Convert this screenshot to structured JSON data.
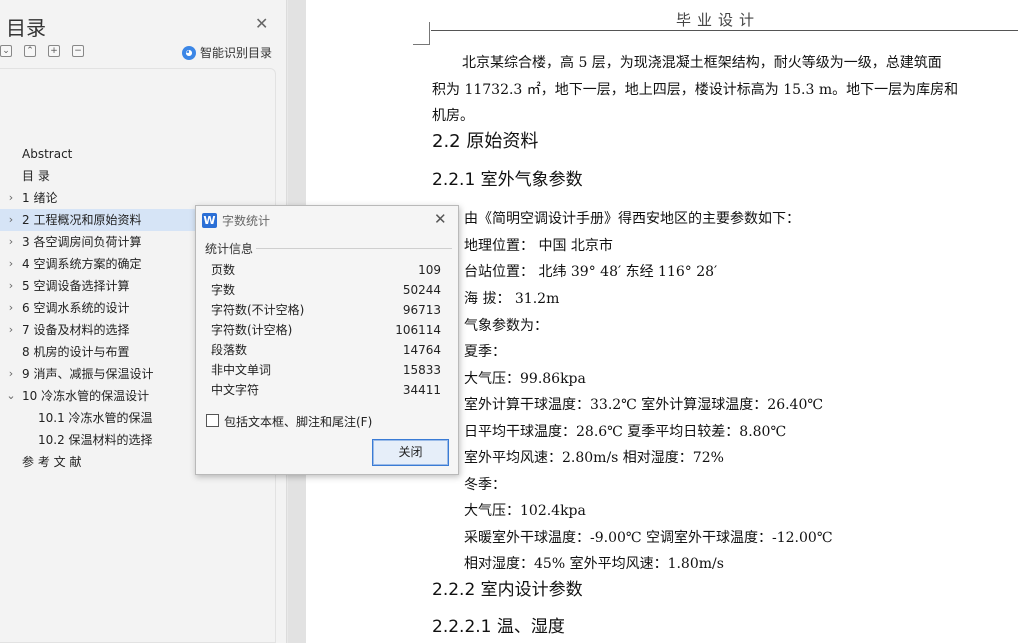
{
  "toc": {
    "title": "目录",
    "smart_label": "智能识别目录",
    "items": [
      {
        "label": "Abstract",
        "level": 0,
        "expandable": false,
        "selected": false
      },
      {
        "label": "目    录",
        "level": 0,
        "expandable": false,
        "selected": false
      },
      {
        "label": "1 绪论",
        "level": 0,
        "expandable": true,
        "expanded": false,
        "selected": false
      },
      {
        "label": "2 工程概况和原始资料",
        "level": 0,
        "expandable": true,
        "expanded": false,
        "selected": true
      },
      {
        "label": "3 各空调房间负荷计算",
        "level": 0,
        "expandable": true,
        "expanded": false,
        "selected": false
      },
      {
        "label": "4 空调系统方案的确定",
        "level": 0,
        "expandable": true,
        "expanded": false,
        "selected": false
      },
      {
        "label": "5 空调设备选择计算",
        "level": 0,
        "expandable": true,
        "expanded": false,
        "selected": false
      },
      {
        "label": "6 空调水系统的设计",
        "level": 0,
        "expandable": true,
        "expanded": false,
        "selected": false
      },
      {
        "label": "7 设备及材料的选择",
        "level": 0,
        "expandable": true,
        "expanded": false,
        "selected": false
      },
      {
        "label": "8 机房的设计与布置",
        "level": 0,
        "expandable": false,
        "selected": false
      },
      {
        "label": "9 消声、减振与保温设计",
        "level": 0,
        "expandable": true,
        "expanded": false,
        "selected": false
      },
      {
        "label": "10 冷冻水管的保温设计",
        "level": 0,
        "expandable": true,
        "expanded": true,
        "selected": false
      },
      {
        "label": "10.1 冷冻水管的保温",
        "level": 1,
        "expandable": false,
        "selected": false
      },
      {
        "label": "10.2  保温材料的选择",
        "level": 1,
        "expandable": false,
        "selected": false
      },
      {
        "label": "参 考 文 献",
        "level": 0,
        "expandable": false,
        "selected": false
      }
    ]
  },
  "document": {
    "header": "毕业设计",
    "intro_lines": [
      "北京某综合楼，高 5 层，为现浇混凝土框架结构，耐火等级为一级，总建筑面",
      "积为 11732.3 ㎡，地下一层，地上四层，楼设计标高为 15.3 m。地下一层为库房和",
      "机房。"
    ],
    "h_2_2": "2.2 原始资料",
    "h_2_2_1": "2.2.1 室外气象参数",
    "climate_lines": [
      "由《简明空调设计手册》得西安地区的主要参数如下：",
      "地理位置：      中国     北京市",
      "台站位置：      北纬 39° 48′      东经 116° 28′",
      "海     拔：       31.2m",
      "气象参数为：",
      "夏季：",
      "大气压：99.86kpa",
      "室外计算干球温度：33.2℃      室外计算湿球温度：26.40℃",
      "日平均干球温度：28.6℃        夏季平均日较差：8.80℃",
      "室外平均风速：2.80m/s            相对湿度：72%",
      "冬季：",
      "大气压：102.4kpa",
      "采暖室外干球温度：-9.00℃        空调室外干球温度：-12.00℃",
      "相对湿度：45%                      室外平均风速：1.80m/s"
    ],
    "h_2_2_2": "2.2.2 室内设计参数",
    "h_2_2_2_1": "2.2.2.1 温、湿度"
  },
  "dialog": {
    "title": "字数统计",
    "section": "统计信息",
    "stats": [
      {
        "label": "页数",
        "value": "109"
      },
      {
        "label": "字数",
        "value": "50244"
      },
      {
        "label": "字符数(不计空格)",
        "value": "96713"
      },
      {
        "label": "字符数(计空格)",
        "value": "106114"
      },
      {
        "label": "段落数",
        "value": "14764"
      },
      {
        "label": "非中文单词",
        "value": "15833"
      },
      {
        "label": "中文字符",
        "value": "34411"
      }
    ],
    "checkbox_label": "包括文本框、脚注和尾注(F)",
    "checkbox_checked": false,
    "close_button": "关闭"
  }
}
